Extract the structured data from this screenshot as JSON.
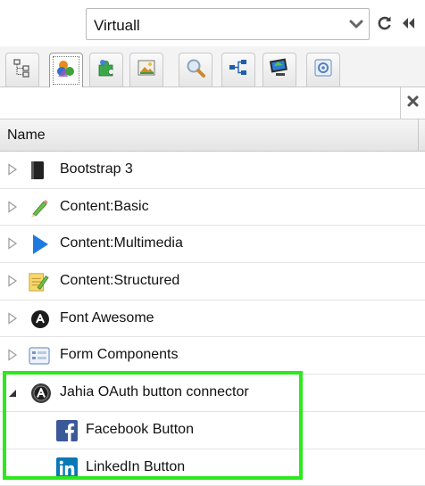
{
  "site_selector": {
    "value": "Virtuall"
  },
  "toolbar": {
    "refresh_icon": "refresh-icon",
    "collapse_icon": "double-chevron-left-icon"
  },
  "tabs": [
    {
      "icon": "tree-structure-icon",
      "active": false
    },
    {
      "icon": "content-types-icon",
      "active": true
    },
    {
      "icon": "puzzle-icon",
      "active": false
    },
    {
      "icon": "image-gallery-icon",
      "active": false
    },
    {
      "icon": "search-icon",
      "active": false
    },
    {
      "icon": "hierarchy-icon",
      "active": false
    },
    {
      "icon": "monitor-icon",
      "active": false
    },
    {
      "icon": "settings-icon",
      "active": false
    }
  ],
  "filter": {
    "value": ""
  },
  "grid": {
    "column_name": "Name",
    "rows": [
      {
        "label": "Bootstrap 3",
        "icon": "book-icon",
        "expander": "collapsed"
      },
      {
        "label": "Content:Basic",
        "icon": "pencil-icon",
        "expander": "collapsed"
      },
      {
        "label": "Content:Multimedia",
        "icon": "play-icon",
        "expander": "collapsed"
      },
      {
        "label": "Content:Structured",
        "icon": "notepad-pencil-icon",
        "expander": "collapsed"
      },
      {
        "label": "Font Awesome",
        "icon": "font-awesome-icon",
        "expander": "collapsed"
      },
      {
        "label": "Form Components",
        "icon": "form-icon",
        "expander": "collapsed"
      },
      {
        "label": "Jahia OAuth button connector",
        "icon": "oauth-icon",
        "expander": "expanded"
      },
      {
        "label": "Facebook Button",
        "icon": "facebook-icon",
        "expander": "none"
      },
      {
        "label": "LinkedIn Button",
        "icon": "linkedin-icon",
        "expander": "none"
      }
    ]
  },
  "colors": {
    "highlight": "#2ee81e",
    "facebook": "#3b5998",
    "linkedin": "#0a77b5"
  }
}
